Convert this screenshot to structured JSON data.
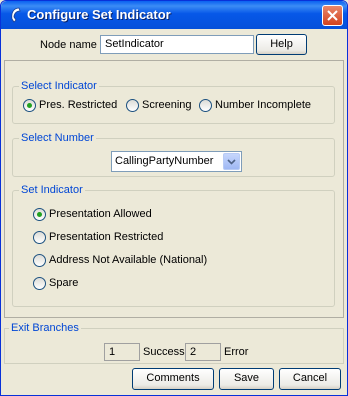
{
  "window": {
    "title": "Configure Set Indicator"
  },
  "node": {
    "label": "Node name",
    "value": "SetIndicator",
    "help_label": "Help"
  },
  "select_indicator": {
    "legend": "Select Indicator",
    "options": [
      "Pres. Restricted",
      "Screening",
      "Number Incomplete"
    ],
    "selected": "Pres. Restricted"
  },
  "select_number": {
    "legend": "Select Number",
    "value": "CallingPartyNumber"
  },
  "set_indicator": {
    "legend": "Set Indicator",
    "options": [
      "Presentation Allowed",
      "Presentation Restricted",
      "Address Not Available (National)",
      "Spare"
    ],
    "selected": "Presentation Allowed"
  },
  "exit_branches": {
    "legend": "Exit Branches",
    "success_count": "1",
    "success_label": "Success",
    "error_count": "2",
    "error_label": "Error"
  },
  "footer": {
    "comments_label": "Comments",
    "save_label": "Save",
    "cancel_label": "Cancel"
  }
}
